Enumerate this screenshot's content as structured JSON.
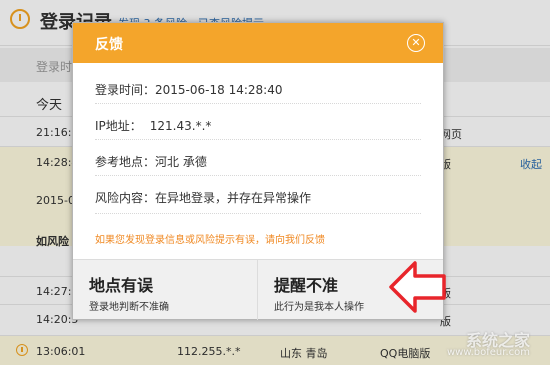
{
  "background": {
    "title": "登录记录",
    "subtitle": "发现 3 条风险，已查风险提示",
    "column_header": "登录时",
    "today_label": "今天",
    "rows": [
      {
        "time": "21:16:2",
        "right": "网页"
      },
      {
        "time": "14:28:4",
        "right": "版",
        "action": "收起"
      },
      {
        "time": "2015-06"
      },
      {
        "time": "如风险"
      },
      {
        "time": "14:27:1",
        "right": "版"
      },
      {
        "time": "14:20:5",
        "right": "版"
      },
      {
        "time": "13:06:01",
        "ip": "112.255.*.*",
        "location": "山东 青岛",
        "right": "QQ电脑版"
      }
    ]
  },
  "modal": {
    "title": "反馈",
    "close_icon": "close-icon",
    "login_time_label": "登录时间：",
    "login_time_value": "2015-06-18 14:28:40",
    "ip_label": "IP地址：",
    "ip_value": "121.43.*.*",
    "location_label": "参考地点：",
    "location_value": "河北 承德",
    "risk_label": "风险内容：",
    "risk_value": "在异地登录，并存在异常操作",
    "note": "如果您发现登录信息或风险提示有误，请向我们反馈",
    "buttons": [
      {
        "title": "地点有误",
        "desc": "登录地判断不准确"
      },
      {
        "title": "提醒不准",
        "desc": "此行为是我本人操作"
      }
    ]
  },
  "watermark": {
    "brand": "系统之家",
    "url": "www.bofeur.com"
  },
  "colors": {
    "header": "#f4a52b",
    "note": "#f08a24",
    "arrow": "#e8252b"
  }
}
